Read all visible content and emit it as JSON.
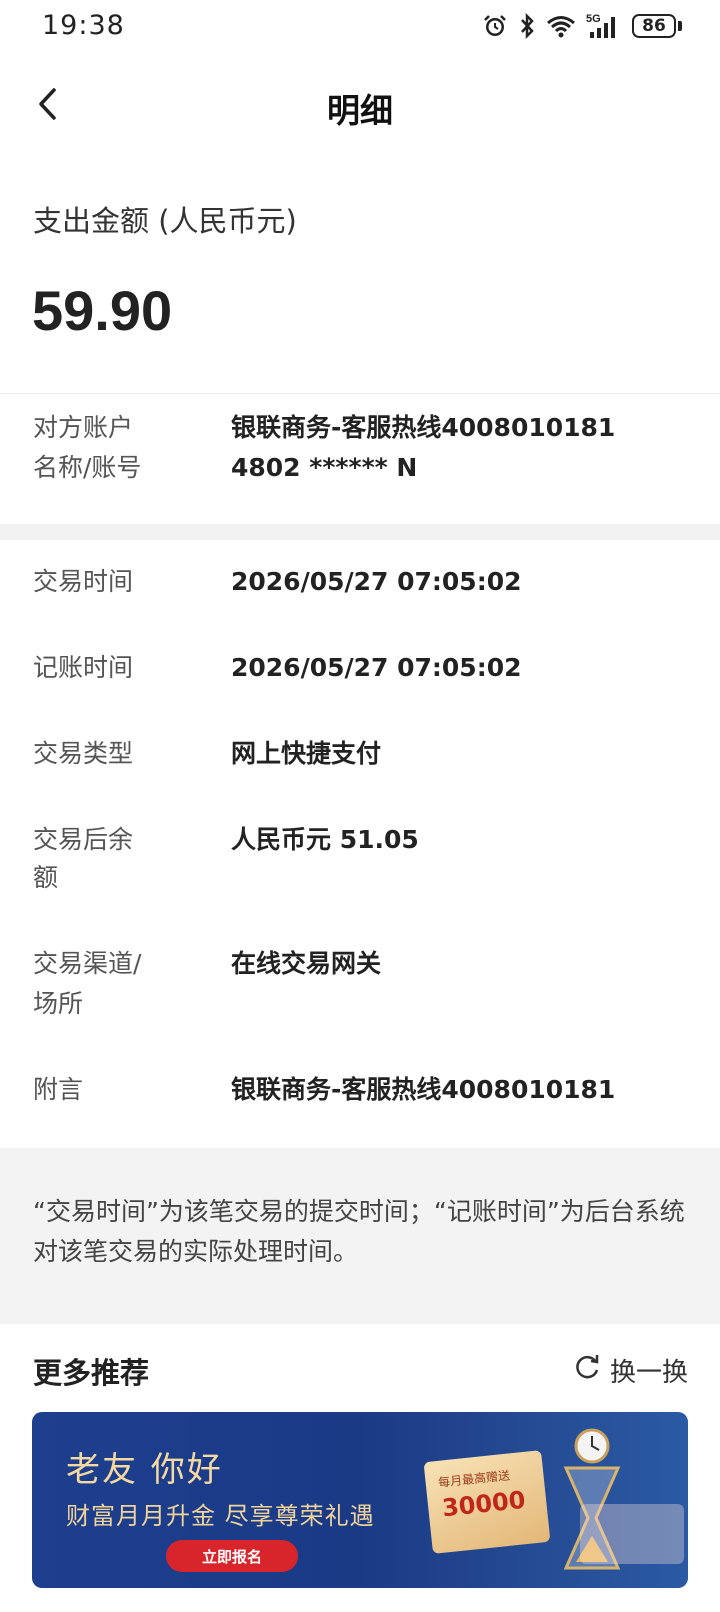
{
  "status_bar": {
    "time": "19:38",
    "network": "5G",
    "battery": "86",
    "icons": [
      "alarm-icon",
      "bluetooth-icon",
      "wifi-icon",
      "signal-icon",
      "battery-icon"
    ]
  },
  "nav": {
    "title": "明细",
    "back_icon": "chevron-left-icon"
  },
  "amount": {
    "label": "支出金额 (人民币元)",
    "value": "59.90"
  },
  "counterparty": {
    "label_line1": "对方账户",
    "label_line2": "名称/账号",
    "value_line1": "银联商务-客服热线4008010181",
    "value_line2": "4802 ****** N"
  },
  "details": [
    {
      "label_lines": [
        "交易时间"
      ],
      "value": "2026/05/27 07:05:02"
    },
    {
      "label_lines": [
        "记账时间"
      ],
      "value": "2026/05/27 07:05:02"
    },
    {
      "label_lines": [
        "交易类型"
      ],
      "value": "网上快捷支付"
    },
    {
      "label_lines": [
        "交易后余",
        "额"
      ],
      "value": "人民币元 51.05"
    },
    {
      "label_lines": [
        "交易渠道/",
        "场所"
      ],
      "value": "在线交易网关"
    },
    {
      "label_lines": [
        "附言"
      ],
      "value": "银联商务-客服热线4008010181"
    }
  ],
  "note": "“交易时间”为该笔交易的提交时间；“记账时间”为后台系统对该笔交易的实际处理时间。",
  "more": {
    "title": "更多推荐",
    "refresh_label": "换一换",
    "banner": {
      "title": "老友 你好",
      "subtitle": "财富月月升金 尽享尊荣礼遇",
      "cta": "立即报名",
      "card_caption": "每月最高赠送",
      "card_number": "30000"
    }
  },
  "colors": {
    "accent_red": "#d8252c",
    "banner_blue": "#1d3f8e",
    "banner_gold": "#f5d9a1",
    "note_bg": "#f3f3f3"
  }
}
